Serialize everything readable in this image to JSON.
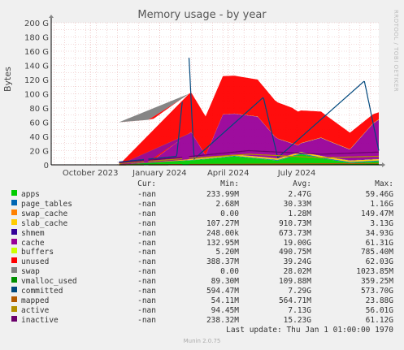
{
  "chart_data": {
    "type": "area",
    "title": "Memory usage - by year",
    "ylabel": "Bytes",
    "side_note": "RRDTOOL / TOBI OETIKER",
    "ylim": [
      0,
      200
    ],
    "yticks": [
      "0",
      "20 G",
      "40 G",
      "60 G",
      "80 G",
      "100 G",
      "120 G",
      "140 G",
      "160 G",
      "180 G",
      "200 G"
    ],
    "xticks": [
      "October 2023",
      "January 2024",
      "April 2024",
      "July 2024"
    ],
    "x_range": [
      "2023-08-10",
      "2024-10-18"
    ],
    "xtick_dates": [
      "2023-10-01",
      "2024-01-01",
      "2024-04-01",
      "2024-07-01"
    ],
    "gaps": [
      [
        "2023-08-10",
        "2023-11-08"
      ],
      [
        "2023-12-12",
        "2023-12-16"
      ],
      [
        "2024-02-01",
        "2024-02-08"
      ]
    ],
    "series": [
      {
        "name": "apps",
        "color": "#00cc00",
        "values": [
          [
            0,
            0
          ],
          [
            10,
            0
          ],
          [
            18,
            4
          ],
          [
            30,
            8
          ],
          [
            40,
            12
          ],
          [
            55,
            6
          ],
          [
            63,
            15
          ],
          [
            72,
            8
          ],
          [
            80,
            3
          ],
          [
            90,
            5
          ]
        ]
      },
      {
        "name": "page_tables",
        "color": "#0066b3",
        "values": [
          [
            0,
            0
          ],
          [
            30,
            0.5
          ],
          [
            60,
            1
          ],
          [
            90,
            1
          ]
        ]
      },
      {
        "name": "swap_cache",
        "color": "#ff8000",
        "values": [
          [
            0,
            0
          ],
          [
            90,
            0
          ]
        ]
      },
      {
        "name": "slab_cache",
        "color": "#ffcc00",
        "values": [
          [
            0,
            0
          ],
          [
            20,
            1
          ],
          [
            50,
            2
          ],
          [
            90,
            2
          ]
        ]
      },
      {
        "name": "shmem",
        "color": "#330099",
        "values": [
          [
            0,
            0
          ],
          [
            90,
            0.5
          ]
        ]
      },
      {
        "name": "cache",
        "color": "#990099",
        "values": [
          [
            0,
            0
          ],
          [
            12,
            5
          ],
          [
            18,
            20
          ],
          [
            25,
            38
          ],
          [
            30,
            3
          ],
          [
            36,
            58
          ],
          [
            48,
            56
          ],
          [
            54,
            30
          ],
          [
            62,
            10
          ],
          [
            70,
            25
          ],
          [
            80,
            15
          ],
          [
            88,
            50
          ],
          [
            90,
            55
          ]
        ]
      },
      {
        "name": "buffers",
        "color": "#ccff00",
        "values": [
          [
            0,
            0
          ],
          [
            90,
            0.5
          ]
        ]
      },
      {
        "name": "unused",
        "color": "#ff0000",
        "values": [
          [
            0,
            60
          ],
          [
            30,
            55
          ],
          [
            60,
            50
          ],
          [
            90,
            10
          ]
        ]
      },
      {
        "name": "swap",
        "color": "#808080",
        "values": [
          [
            0,
            0
          ],
          [
            90,
            0
          ]
        ]
      },
      {
        "name": "vmalloc_used",
        "color": "#008f00",
        "values": [
          [
            0,
            0
          ],
          [
            90,
            0.3
          ]
        ]
      },
      {
        "name": "committed",
        "color": "#00487d",
        "values": [
          [
            0,
            4
          ],
          [
            20,
            12
          ],
          [
            24,
            172
          ],
          [
            26,
            8
          ],
          [
            50,
            95
          ],
          [
            55,
            10
          ],
          [
            85,
            118
          ],
          [
            90,
            20
          ]
        ]
      },
      {
        "name": "mapped",
        "color": "#b35a00",
        "values": [
          [
            0,
            0
          ],
          [
            90,
            2
          ]
        ]
      },
      {
        "name": "active",
        "color": "#b38f00",
        "values": [
          [
            0,
            2
          ],
          [
            20,
            8
          ],
          [
            45,
            15
          ],
          [
            70,
            10
          ],
          [
            90,
            12
          ]
        ]
      },
      {
        "name": "inactive",
        "color": "#6b006b",
        "values": [
          [
            0,
            3
          ],
          [
            20,
            10
          ],
          [
            45,
            20
          ],
          [
            70,
            15
          ],
          [
            90,
            18
          ]
        ]
      }
    ]
  },
  "legend": {
    "headers": {
      "cur": "Cur:",
      "min": "Min:",
      "avg": "Avg:",
      "max": "Max:"
    },
    "rows": [
      {
        "name": "apps",
        "color": "#00cc00",
        "cur": "-nan",
        "min": "233.99M",
        "avg": "2.47G",
        "max": "59.46G"
      },
      {
        "name": "page_tables",
        "color": "#0066b3",
        "cur": "-nan",
        "min": "2.68M",
        "avg": "30.33M",
        "max": "1.16G"
      },
      {
        "name": "swap_cache",
        "color": "#ff8000",
        "cur": "-nan",
        "min": "0.00",
        "avg": "1.28M",
        "max": "149.47M"
      },
      {
        "name": "slab_cache",
        "color": "#ffcc00",
        "cur": "-nan",
        "min": "107.27M",
        "avg": "910.73M",
        "max": "3.13G"
      },
      {
        "name": "shmem",
        "color": "#330099",
        "cur": "-nan",
        "min": "248.00k",
        "avg": "673.73M",
        "max": "34.93G"
      },
      {
        "name": "cache",
        "color": "#990099",
        "cur": "-nan",
        "min": "132.95M",
        "avg": "19.00G",
        "max": "61.31G"
      },
      {
        "name": "buffers",
        "color": "#ccff00",
        "cur": "-nan",
        "min": "5.20M",
        "avg": "490.75M",
        "max": "785.40M"
      },
      {
        "name": "unused",
        "color": "#ff0000",
        "cur": "-nan",
        "min": "388.37M",
        "avg": "39.24G",
        "max": "62.03G"
      },
      {
        "name": "swap",
        "color": "#808080",
        "cur": "-nan",
        "min": "0.00",
        "avg": "28.02M",
        "max": "1023.85M"
      },
      {
        "name": "vmalloc_used",
        "color": "#008f00",
        "cur": "-nan",
        "min": "89.30M",
        "avg": "109.88M",
        "max": "359.25M"
      },
      {
        "name": "committed",
        "color": "#00487d",
        "cur": "-nan",
        "min": "594.47M",
        "avg": "7.29G",
        "max": "573.70G"
      },
      {
        "name": "mapped",
        "color": "#b35a00",
        "cur": "-nan",
        "min": "54.11M",
        "avg": "564.71M",
        "max": "23.88G"
      },
      {
        "name": "active",
        "color": "#b38f00",
        "cur": "-nan",
        "min": "94.45M",
        "avg": "7.13G",
        "max": "56.01G"
      },
      {
        "name": "inactive",
        "color": "#6b006b",
        "cur": "-nan",
        "min": "238.32M",
        "avg": "15.23G",
        "max": "61.12G"
      }
    ]
  },
  "footer": {
    "last_update": "Last update: Thu Jan  1 01:00:00 1970",
    "version": "Munin 2.0.75"
  }
}
